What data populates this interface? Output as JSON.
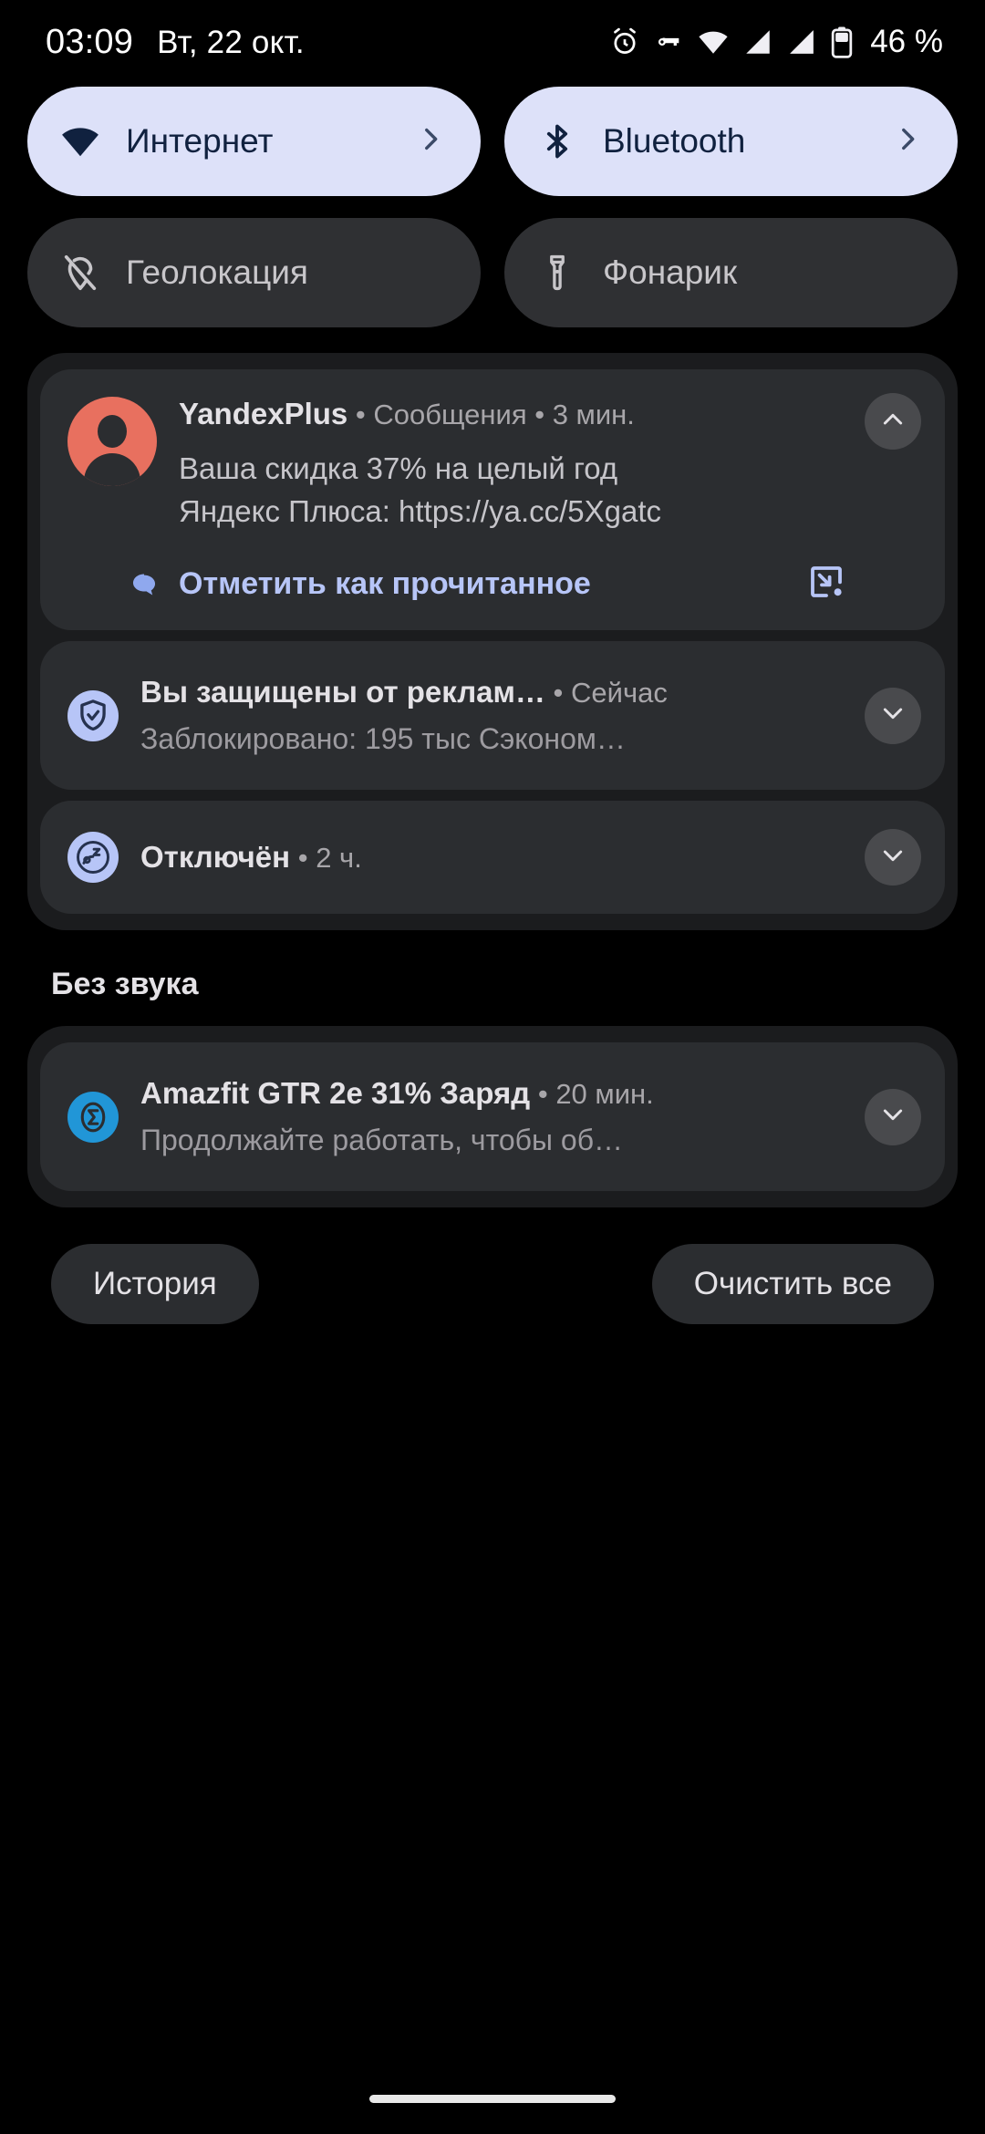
{
  "status_bar": {
    "time": "03:09",
    "date": "Вт, 22 окт.",
    "battery_percent": "46 %",
    "icons": [
      "alarm-icon",
      "vpn-key-icon",
      "wifi-icon",
      "signal-sim1-icon",
      "signal-sim2-icon",
      "battery-icon"
    ]
  },
  "quick_settings": {
    "tiles": [
      {
        "label": "Интернет",
        "icon": "wifi-icon",
        "state": "active",
        "chevron": true
      },
      {
        "label": "Bluetooth",
        "icon": "bluetooth-icon",
        "state": "active",
        "chevron": true
      },
      {
        "label": "Геолокация",
        "icon": "location-off-icon",
        "state": "inactive",
        "chevron": false
      },
      {
        "label": "Фонарик",
        "icon": "flashlight-icon",
        "state": "inactive",
        "chevron": false
      }
    ]
  },
  "notifications": {
    "primary": {
      "app": "YandexPlus",
      "separator1": " • ",
      "channel": "Сообщения",
      "separator2": " • ",
      "time": "3 мин.",
      "text_line1": "Ваша скидка 37% на целый год",
      "text_line2": "Яндекс Плюса: https://ya.cc/5Xgatc",
      "action_label": "Отметить как прочитанное",
      "action_icon": "open-in-new-reply-icon",
      "expand_icon": "chevron-up-icon",
      "avatar_icon": "person-avatar",
      "badge_icon": "chat-bubble-icon"
    },
    "adguard": {
      "title": "Вы защищены от реклам…",
      "separator": " • ",
      "time": "Сейчас",
      "subtitle": "Заблокировано: 195 тыс Сэконом…",
      "icon": "shield-check-icon",
      "expand_icon": "chevron-down-icon"
    },
    "bedtime": {
      "title": "Отключён",
      "separator": " • ",
      "time": "2 ч.",
      "subtitle": "",
      "icon": "bedtime-icon",
      "expand_icon": "chevron-down-icon"
    },
    "silent_section_label": "Без звука",
    "amazfit": {
      "title": "Amazfit GTR 2e 31% Заряд",
      "separator": " • ",
      "time": "20 мин.",
      "subtitle": "Продолжайте работать, чтобы об…",
      "icon": "zepp-sigma-icon",
      "expand_icon": "chevron-down-icon"
    }
  },
  "footer": {
    "history_label": "История",
    "clear_all_label": "Очистить все"
  },
  "colors": {
    "background": "#000000",
    "tile_active_bg": "#DDE1F9",
    "tile_active_fg": "#10213F",
    "tile_inactive_bg": "#2F3033",
    "notification_bg": "#2B2D30",
    "group_bg": "#1B1C1E",
    "accent_blue": "#B7C5F7",
    "avatar_bg": "#E8705F",
    "zepp_blue": "#2196D7"
  }
}
